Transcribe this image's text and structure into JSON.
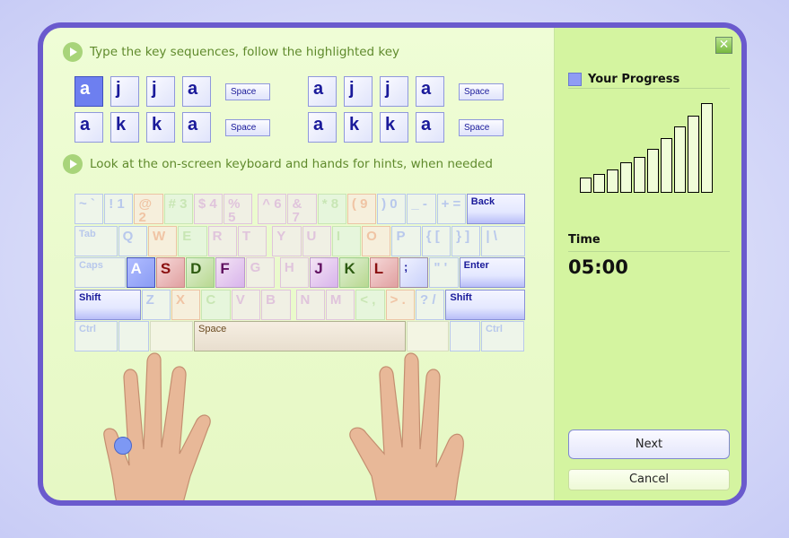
{
  "instructions": {
    "step1": "Type the key sequences, follow the highlighted key",
    "step2": "Look at the on-screen keyboard and hands for hints, when needed"
  },
  "sequences": [
    {
      "keys": [
        "a",
        "j",
        "j",
        "a"
      ],
      "space": "Space",
      "active_index": 0
    },
    {
      "keys": [
        "a",
        "j",
        "j",
        "a"
      ],
      "space": "Space"
    },
    {
      "keys": [
        "a",
        "k",
        "k",
        "a"
      ],
      "space": "Space"
    },
    {
      "keys": [
        "a",
        "k",
        "k",
        "a"
      ],
      "space": "Space"
    }
  ],
  "keyboard": {
    "rows": [
      [
        {
          "l": "~ `",
          "c": "b"
        },
        {
          "l": "! 1",
          "c": "b"
        },
        {
          "l": "@ 2",
          "c": "o"
        },
        {
          "l": "# 3",
          "c": "g"
        },
        {
          "l": "$ 4",
          "c": "p"
        },
        {
          "l": "% 5",
          "c": "p"
        },
        {
          "gap": true
        },
        {
          "l": "^ 6",
          "c": "p"
        },
        {
          "l": "& 7",
          "c": "p"
        },
        {
          "l": "* 8",
          "c": "g"
        },
        {
          "l": "( 9",
          "c": "o"
        },
        {
          "l": ") 0",
          "c": "b"
        },
        {
          "l": "_ -",
          "c": "b"
        },
        {
          "l": "+ =",
          "c": "b"
        },
        {
          "l": "Back",
          "c": "sys",
          "w": 66
        }
      ],
      [
        {
          "l": "Tab",
          "c": "b",
          "w": 48,
          "s": 1
        },
        {
          "l": "Q",
          "c": "b"
        },
        {
          "l": "W",
          "c": "o"
        },
        {
          "l": "E",
          "c": "g"
        },
        {
          "l": "R",
          "c": "p"
        },
        {
          "l": "T",
          "c": "p"
        },
        {
          "gap": true
        },
        {
          "l": "Y",
          "c": "p"
        },
        {
          "l": "U",
          "c": "p"
        },
        {
          "l": "I",
          "c": "g"
        },
        {
          "l": "O",
          "c": "o"
        },
        {
          "l": "P",
          "c": "b"
        },
        {
          "l": "{ [",
          "c": "b"
        },
        {
          "l": "} ]",
          "c": "b"
        },
        {
          "l": "| \\",
          "c": "b",
          "w": 49
        }
      ],
      [
        {
          "l": "Caps",
          "c": "b",
          "w": 57,
          "s": 1
        },
        {
          "l": "A",
          "c": "Ab"
        },
        {
          "l": "S",
          "c": "As"
        },
        {
          "l": "D",
          "c": "Ag"
        },
        {
          "l": "F",
          "c": "Ap"
        },
        {
          "l": "G",
          "c": "p"
        },
        {
          "gap": true
        },
        {
          "l": "H",
          "c": "p"
        },
        {
          "l": "J",
          "c": "Ap"
        },
        {
          "l": "K",
          "c": "Ag"
        },
        {
          "l": "L",
          "c": "As"
        },
        {
          "l": ";",
          "c": "Abs"
        },
        {
          "l": "\" '",
          "c": "b"
        },
        {
          "l": "Enter",
          "c": "sys",
          "w": 74
        }
      ],
      [
        {
          "l": "Shift",
          "c": "sys",
          "w": 74
        },
        {
          "l": "Z",
          "c": "b"
        },
        {
          "l": "X",
          "c": "o"
        },
        {
          "l": "C",
          "c": "g"
        },
        {
          "l": "V",
          "c": "p"
        },
        {
          "l": "B",
          "c": "p"
        },
        {
          "gap": true
        },
        {
          "l": "N",
          "c": "p"
        },
        {
          "l": "M",
          "c": "p"
        },
        {
          "l": "< ,",
          "c": "g"
        },
        {
          "l": "> .",
          "c": "o"
        },
        {
          "l": "? /",
          "c": "b"
        },
        {
          "l": "Shift",
          "c": "sys",
          "w": 89
        }
      ],
      [
        {
          "l": "Ctrl",
          "c": "b",
          "w": 48,
          "s": 1
        },
        {
          "l": "",
          "c": "b",
          "w": 34
        },
        {
          "l": "",
          "c": "n",
          "w": 48
        },
        {
          "l": "Space",
          "c": "space",
          "w": 236
        },
        {
          "l": "",
          "c": "n",
          "w": 47
        },
        {
          "l": "",
          "c": "b",
          "w": 34
        },
        {
          "l": "Ctrl",
          "c": "b",
          "w": 48,
          "s": 1
        }
      ]
    ]
  },
  "hint_finger": "left-pinky",
  "sidebar": {
    "close_icon": "close-icon",
    "progress_title": "Your Progress",
    "progress_levels": [
      0.17,
      0.21,
      0.26,
      0.34,
      0.4,
      0.49,
      0.61,
      0.74,
      0.86,
      1.0
    ],
    "time_label": "Time",
    "time_value": "05:00",
    "next_label": "Next",
    "cancel_label": "Cancel"
  },
  "colors": {
    "frame": "#6a5acd",
    "sidebar": "#d4f4a0",
    "main": "#effdd6",
    "active_key": "#6d7ff0"
  }
}
